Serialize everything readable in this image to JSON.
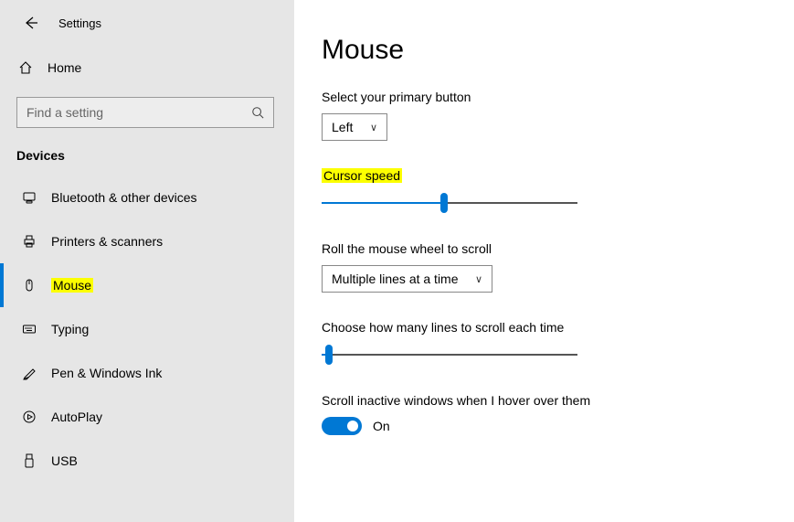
{
  "header": {
    "back_label": "",
    "settings_label": "Settings"
  },
  "sidebar": {
    "home_label": "Home",
    "search_placeholder": "Find a setting",
    "section_label": "Devices",
    "items": [
      {
        "label": "Bluetooth & other devices"
      },
      {
        "label": "Printers & scanners"
      },
      {
        "label": "Mouse"
      },
      {
        "label": "Typing"
      },
      {
        "label": "Pen & Windows Ink"
      },
      {
        "label": "AutoPlay"
      },
      {
        "label": "USB"
      }
    ]
  },
  "main": {
    "title": "Mouse",
    "primary_button_label": "Select your primary button",
    "primary_button_value": "Left",
    "cursor_speed_label": "Cursor speed",
    "cursor_speed_percent": 48,
    "scroll_mode_label": "Roll the mouse wheel to scroll",
    "scroll_mode_value": "Multiple lines at a time",
    "scroll_lines_label": "Choose how many lines to scroll each time",
    "scroll_lines_percent": 3,
    "inactive_label": "Scroll inactive windows when I hover over them",
    "inactive_value": "On"
  }
}
